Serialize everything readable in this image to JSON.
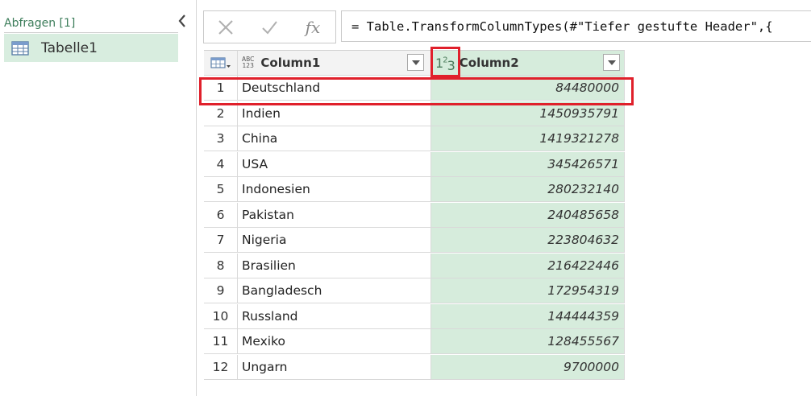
{
  "queries": {
    "header": "Abfragen [1]",
    "items": [
      {
        "label": "Tabelle1"
      }
    ]
  },
  "formula_bar": {
    "cancel_icon": "x-icon",
    "commit_icon": "check-icon",
    "fx_label": "fx",
    "formula": "= Table.TransformColumnTypes(#\"Tiefer gestufte Header\",{"
  },
  "table": {
    "columns": [
      {
        "name": "Column1",
        "type_icon": "ABC/123"
      },
      {
        "name": "Column2",
        "type_icon": "1²3"
      }
    ],
    "rows": [
      {
        "num": "1",
        "col1": "Deutschland",
        "col2": "84480000"
      },
      {
        "num": "2",
        "col1": "Indien",
        "col2": "1450935791"
      },
      {
        "num": "3",
        "col1": "China",
        "col2": "1419321278"
      },
      {
        "num": "4",
        "col1": "USA",
        "col2": "345426571"
      },
      {
        "num": "5",
        "col1": "Indonesien",
        "col2": "280232140"
      },
      {
        "num": "6",
        "col1": "Pakistan",
        "col2": "240485658"
      },
      {
        "num": "7",
        "col1": "Nigeria",
        "col2": "223804632"
      },
      {
        "num": "8",
        "col1": "Brasilien",
        "col2": "216422446"
      },
      {
        "num": "9",
        "col1": "Bangladesch",
        "col2": "172954319"
      },
      {
        "num": "10",
        "col1": "Russland",
        "col2": "144444359"
      },
      {
        "num": "11",
        "col1": "Mexiko",
        "col2": "128455567"
      },
      {
        "num": "12",
        "col1": "Ungarn",
        "col2": "9700000"
      }
    ]
  },
  "colors": {
    "accent_green": "#d6ecdc",
    "highlight_red": "#e0202b"
  }
}
